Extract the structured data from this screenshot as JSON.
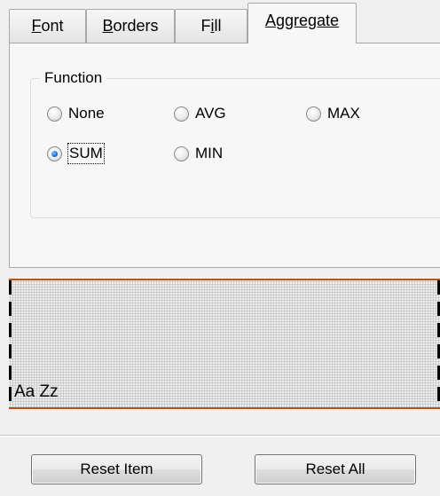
{
  "tabs": [
    {
      "accel": "F",
      "rest": "ont",
      "active": false
    },
    {
      "accel": "B",
      "rest": "orders",
      "active": false
    },
    {
      "pre": "F",
      "accel": "i",
      "rest": "ll",
      "active": false
    },
    {
      "accel": "A",
      "rest": "ggregate",
      "active": true
    }
  ],
  "function_group": {
    "title": "Function",
    "options": [
      {
        "label": "None",
        "checked": false
      },
      {
        "label": "AVG",
        "checked": false
      },
      {
        "label": "MAX",
        "checked": false
      },
      {
        "label": "SUM",
        "checked": true
      },
      {
        "label": "MIN",
        "checked": false
      }
    ]
  },
  "preview": {
    "sample_text": "Aa Zz",
    "border_color": "#b5551a"
  },
  "buttons": {
    "reset_item": "Reset Item",
    "reset_all": "Reset All"
  },
  "colors": {
    "accent_radio": "#1b6fd1",
    "background": "#f0f0f0",
    "panel": "#f7f7f7"
  }
}
